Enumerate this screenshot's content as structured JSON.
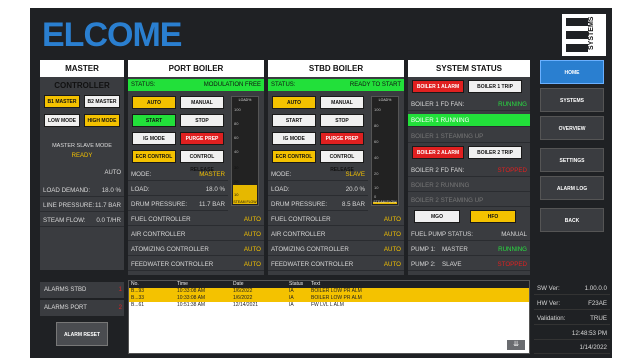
{
  "brand": {
    "logo_text": "ELCOME",
    "side_logo_text": "SYSTEMS"
  },
  "master": {
    "title": "MASTER CONTROLLER",
    "b1": "B1 MASTER",
    "b2": "B2 MASTER",
    "low": "LOW MODE",
    "high": "HIGH MODE",
    "slave_mode_label": "MASTER SLAVE MODE",
    "slave_mode_value": "READY",
    "auto": "AUTO",
    "load_label": "LOAD DEMAND:",
    "load_value": "18.0 %",
    "pressure_label": "LINE PRESSURE:",
    "pressure_value": "11.7 BAR",
    "steam_label": "STEAM FLOW:",
    "steam_value": "0.0 T/HR"
  },
  "port": {
    "title": "PORT BOILER",
    "status_label": "STATUS:",
    "status_value": "MODULATION FREE",
    "auto": "AUTO",
    "manual": "MANUAL",
    "start": "START",
    "stop": "STOP",
    "ig": "IG MODE",
    "purge": "PURGE PREP",
    "ecr": "ECR CONTROL",
    "release": "CONTROL RELEASE",
    "mode_label": "MODE:",
    "mode_value": "MASTER",
    "load_label": "LOAD:",
    "load_value": "18.0 %",
    "drum_label": "DRUM PRESSURE:",
    "drum_value": "11.7 BAR",
    "gauge_top": "LOAD%",
    "gauge_bottom": "STEAM FLOW",
    "gauge_ticks": [
      "100",
      "80",
      "60",
      "40",
      "30",
      "20",
      "10"
    ],
    "gauge_level": 0.18
  },
  "stbd": {
    "title": "STBD BOILER",
    "status_label": "STATUS:",
    "status_value": "READY TO START",
    "auto": "AUTO",
    "manual": "MANUAL",
    "start": "START",
    "stop": "STOP",
    "ig": "IG MODE",
    "purge": "PURGE PREP",
    "ecr": "ECR CONTROL",
    "release": "CONTROL RELEASE",
    "mode_label": "MODE:",
    "mode_value": "SLAVE",
    "load_label": "LOAD:",
    "load_value": "20.0 %",
    "drum_label": "DRUM PRESSURE:",
    "drum_value": "8.5 BAR",
    "gauge_top": "LOAD%",
    "gauge_bottom": "STEAM FLOW",
    "gauge_ticks": [
      "100",
      "80",
      "60",
      "40",
      "20",
      "10",
      "0"
    ],
    "gauge_level": 0.02
  },
  "controllers": [
    {
      "label": "FUEL CONTROLLER",
      "value": "AUTO"
    },
    {
      "label": "AIR CONTROLLER",
      "value": "AUTO"
    },
    {
      "label": "ATOMIZING CONTROLLER",
      "value": "AUTO"
    },
    {
      "label": "FEEDWATER CONTROLLER",
      "value": "AUTO"
    }
  ],
  "system": {
    "title": "SYSTEM STATUS",
    "b1_alarm": "BOILER 1 ALARM",
    "b1_trip": "BOILER 1 TRIP",
    "b1_fd_label": "BOILER 1 FD FAN:",
    "b1_fd_value": "RUNNING",
    "b1_running": "BOILER 1 RUNNING",
    "b1_steam": "BOILER 1 STEAMING UP",
    "b2_alarm": "BOILER 2 ALARM",
    "b2_trip": "BOILER 2 TRIP",
    "b2_fd_label": "BOILER 2 FD FAN:",
    "b2_fd_value": "STOPPED",
    "b2_running": "BOILER 2 RUNNING",
    "b2_steam": "BOILER 2 STEAMING UP",
    "mgo": "MGO",
    "hfo": "HFO",
    "fuel_pump_label": "FUEL PUMP STATUS:",
    "fuel_pump_value": "MANUAL",
    "pump1_label": "PUMP 1:",
    "pump1_role": "MASTER",
    "pump1_value": "RUNNING",
    "pump2_label": "PUMP 2:",
    "pump2_role": "SLAVE",
    "pump2_value": "STOPPED"
  },
  "nav": {
    "home": "HOME",
    "systems": "SYSTEMS",
    "overview": "OVERVIEW",
    "settings": "SETTINGS",
    "alarm_log": "ALARM LOG",
    "back": "BACK"
  },
  "alarms": {
    "stbd_label": "ALARMS STBD",
    "stbd_count": "1",
    "port_label": "ALARMS PORT",
    "port_count": "2",
    "reset": "ALARM RESET",
    "headers": [
      "No.",
      "Time",
      "Date",
      "Status",
      "Text"
    ],
    "rows": [
      [
        "B...93",
        "10:33:08 AM",
        "1/6/2022",
        "IA",
        "BOILER LOW PR ALM"
      ],
      [
        "B...33",
        "10:33:08 AM",
        "1/6/2022",
        "IA",
        "BOILER LOW PR ALM"
      ],
      [
        "B...61",
        "10:51:38 AM",
        "12/14/2021",
        "IA",
        "FW LVL L ALM"
      ]
    ]
  },
  "versions": {
    "sw_label": "SW Ver:",
    "sw_value": "1.00.0.0",
    "hw_label": "HW Ver:",
    "hw_value": "F23AE",
    "val_label": "Validation:",
    "val_value": "TRUE",
    "time": "12:48:53 PM",
    "date": "1/14/2022"
  },
  "colors": {
    "accent": "#f4c200",
    "running": "#28e040",
    "stopped": "#e02020",
    "panel": "#3a3c40"
  }
}
